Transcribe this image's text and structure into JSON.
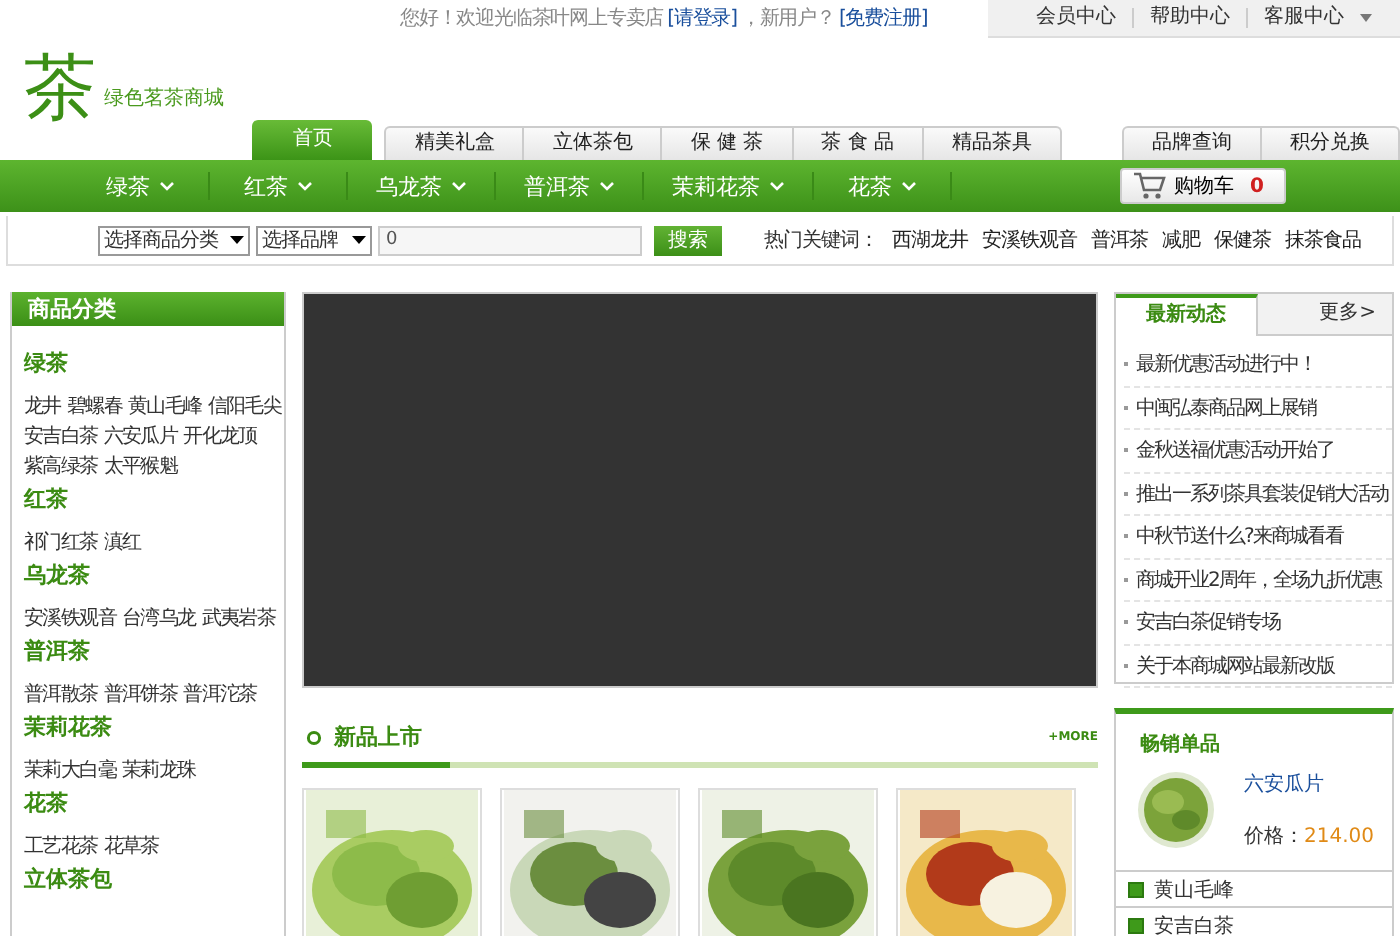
{
  "top_bar": {
    "greeting": "您好！欢迎光临茶叶网上专卖店",
    "login_link": "[请登录]",
    "new_user": "，新用户？",
    "register_link": "[免费注册]",
    "links": [
      "会员中心",
      "帮助中心",
      "客服中心"
    ]
  },
  "logo": {
    "mark": "茶",
    "name": "绿色茗茶商城"
  },
  "tab_groups": [
    [
      {
        "label": "首页",
        "selected": true
      }
    ],
    [
      {
        "label": "精美礼盒",
        "selected": false
      },
      {
        "label": "立体茶包",
        "selected": false
      },
      {
        "label": "保 健 茶",
        "selected": false
      },
      {
        "label": "茶 食 品",
        "selected": false
      },
      {
        "label": "精品茶具",
        "selected": false
      }
    ],
    [
      {
        "label": "品牌查询",
        "selected": false
      },
      {
        "label": "积分兑换",
        "selected": false
      }
    ]
  ],
  "category_nav": [
    "绿茶",
    "红茶",
    "乌龙茶",
    "普洱茶",
    "茉莉花茶",
    "花茶"
  ],
  "cart": {
    "label": "购物车",
    "count": "0"
  },
  "search": {
    "category_select": "选择商品分类",
    "brand_select": "选择品牌",
    "value": "0",
    "button": "搜索",
    "hot_label": "热门关键词：",
    "hot_keywords": [
      "西湖龙井",
      "安溪铁观音",
      "普洱茶",
      "减肥",
      "保健茶",
      "抹茶食品"
    ]
  },
  "sidebar": {
    "title": "商品分类",
    "groups": [
      {
        "name": "绿茶",
        "items": [
          "龙井",
          "碧螺春",
          "黄山毛峰",
          "信阳毛尖",
          "安吉白茶",
          "六安瓜片",
          "开化龙顶",
          "紫高绿茶",
          "太平猴魁"
        ]
      },
      {
        "name": "红茶",
        "items": [
          "祁门红茶",
          "滇红"
        ]
      },
      {
        "name": "乌龙茶",
        "items": [
          "安溪铁观音",
          "台湾乌龙",
          "武夷岩茶"
        ]
      },
      {
        "name": "普洱茶",
        "items": [
          "普洱散茶",
          "普洱饼茶",
          "普洱沱茶"
        ]
      },
      {
        "name": "茉莉花茶",
        "items": [
          "茉莉大白毫",
          "茉莉龙珠"
        ]
      },
      {
        "name": "花茶",
        "items": [
          "工艺花茶",
          "花草茶"
        ]
      },
      {
        "name": "立体茶包"
      }
    ]
  },
  "new_products": {
    "title": "新品上市",
    "more": "+MORE"
  },
  "news": {
    "tab": "最新动态",
    "more": "更多>",
    "items": [
      "最新优惠活动进行中！",
      "中闽弘泰商品网上展销",
      "金秋送福优惠活动开始了",
      "推出一系列茶具套装促销大活动",
      "中秋节送什么?来商城看看",
      "商城开业2周年，全场九折优惠",
      "安吉白茶促销专场",
      "关于本商城网站最新改版"
    ]
  },
  "bestsellers": {
    "title": "畅销单品",
    "featured": {
      "name": "六安瓜片",
      "price_label": "价格：",
      "price": "214.00"
    },
    "items": [
      "黄山毛峰",
      "安吉白茶"
    ]
  }
}
